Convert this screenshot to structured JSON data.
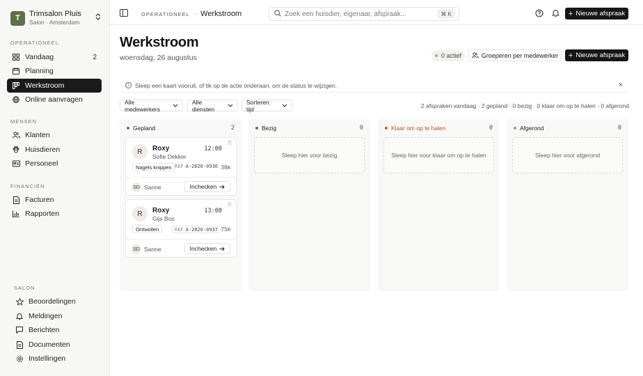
{
  "brand": {
    "logo_letter": "T",
    "name": "Trimsalon Pluis",
    "subtitle": "Salon · Amsterdam",
    "switch_icon": "chevron-updown-icon"
  },
  "sidebar": {
    "sections": [
      {
        "title": "OPERATIONEEL",
        "items": [
          {
            "label": "Vandaag",
            "icon": "grid-icon",
            "count": "2"
          },
          {
            "label": "Planning",
            "icon": "calendar-icon"
          },
          {
            "label": "Werkstroom",
            "icon": "kanban-icon",
            "active": true
          },
          {
            "label": "Online aanvragen",
            "icon": "globe-icon"
          }
        ]
      },
      {
        "title": "MENSEN",
        "items": [
          {
            "label": "Klanten",
            "icon": "users-icon"
          },
          {
            "label": "Huisdieren",
            "icon": "paw-icon"
          },
          {
            "label": "Personeel",
            "icon": "id-card-icon"
          }
        ]
      },
      {
        "title": "FINANCIËN",
        "items": [
          {
            "label": "Facturen",
            "icon": "file-icon"
          },
          {
            "label": "Rapporten",
            "icon": "bar-chart-icon"
          }
        ]
      },
      {
        "title": "SALON",
        "items": [
          {
            "label": "Beoordelingen",
            "icon": "star-icon"
          },
          {
            "label": "Meldingen",
            "icon": "bell-icon"
          },
          {
            "label": "Berichten",
            "icon": "message-icon"
          },
          {
            "label": "Documenten",
            "icon": "document-icon"
          },
          {
            "label": "Instellingen",
            "icon": "gear-icon"
          }
        ]
      }
    ]
  },
  "topbar": {
    "breadcrumb_section": "OPERATIONEEL",
    "breadcrumb_separator": "·",
    "breadcrumb_current": "Werkstroom",
    "search_placeholder": "Zoek een huisdier, eigenaar, afspraak...",
    "search_shortcut": "⌘ K",
    "new_appointment": "Nieuwe afspraak"
  },
  "header": {
    "title": "Werkstroom",
    "date": "woensdag, 26 augustus",
    "active_badge": "0 actief",
    "group_button": "Groeperen per medewerker",
    "new_appointment": "Nieuwe afspraak"
  },
  "info": {
    "text": "Sleep een kaart vooruit, of tik op de actie onderaan, om de status te wijzigen."
  },
  "filters": {
    "staff": "Alle medewerkers",
    "services": "Alle diensten",
    "sort": "Sorteren: tijd"
  },
  "stats": "2 afspraken vandaag · 2 gepland · 0 bezig · 0 klaar om op te halen · 0 afgerond",
  "columns": [
    {
      "title": "Gepland",
      "count": "2",
      "color": "#6b6b6b"
    },
    {
      "title": "Bezig",
      "count": "0",
      "color": "#6b6b6b",
      "drop_text": "Sleep hier voor bezig"
    },
    {
      "title": "Klaar om op te halen",
      "count": "0",
      "color": "#c0683a",
      "drop_text": "Sleep hier voor klaar om op te halen"
    },
    {
      "title": "Afgerond",
      "count": "0",
      "color": "#9a9a9a",
      "drop_text": "Sleep hier voor afgerond"
    }
  ],
  "cards": [
    {
      "avatar": "R",
      "pet": "Roxy",
      "owner": "Sofie Dekker",
      "time": "12:00",
      "service": "Nagels knippen",
      "ref_label": "REF",
      "ref": "A-2026-0936",
      "duration": "30m",
      "staff_initials": "SD",
      "staff": "Sanne",
      "action": "Inchecken"
    },
    {
      "avatar": "R",
      "pet": "Roxy",
      "owner": "Gijs Bos",
      "time": "13:00",
      "service": "Ontwollen",
      "ref_label": "REF",
      "ref": "A-2026-0937",
      "duration": "75m",
      "staff_initials": "SD",
      "staff": "Sanne",
      "action": "Inchecken"
    }
  ]
}
